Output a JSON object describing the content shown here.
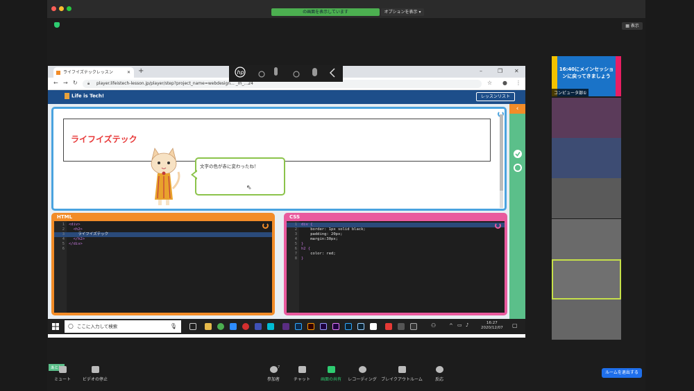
{
  "zoom": {
    "share_status": "の画面を表示しています",
    "options_label": "オプションを表示",
    "view_label": "表示",
    "bottom": {
      "mute": "ミュート",
      "video_stop": "ビデオの停止",
      "participants": "参加者",
      "participants_count": "7",
      "chat": "チャット",
      "share": "画面の共有",
      "record": "レコーディング",
      "breakout": "ブレイクアウトルーム",
      "reactions": "反応",
      "leave": "ルームを退出する",
      "speaker_tag": "あとし"
    },
    "gallery": {
      "banner_text": "16:40にメインセッションに戻ってきましょう",
      "first_name": "コンピュータ部①"
    }
  },
  "browser": {
    "tab_title": "ライフイズテックレッスン",
    "new_tab": "+",
    "url": "player.lifeistech-lesson.jp/player/step?project_name=webdesign... _m_...24",
    "minimize": "–",
    "maximize": "❐",
    "close": "✕",
    "tab_close": "✕"
  },
  "site": {
    "logo": "Life is Tech!",
    "lesson_list": "レッスンリスト",
    "preview_heading": "ライフイズテック",
    "bubble_text": "文字の色が赤に変わったね！"
  },
  "html_editor": {
    "title": "HTML",
    "lines": [
      {
        "n": "1",
        "code": "<div>"
      },
      {
        "n": "2",
        "code": "  <h2>"
      },
      {
        "n": "3",
        "code": "    ライフイズテック"
      },
      {
        "n": "4",
        "code": "  </h2>"
      },
      {
        "n": "5",
        "code": "</div>"
      },
      {
        "n": "6",
        "code": ""
      }
    ]
  },
  "css_editor": {
    "title": "CSS",
    "lines": [
      {
        "n": "1",
        "code": "div {"
      },
      {
        "n": "2",
        "code": "    border: 1px solid black;"
      },
      {
        "n": "3",
        "code": "    padding: 20px;"
      },
      {
        "n": "4",
        "code": "    margin:30px;"
      },
      {
        "n": "5",
        "code": "}"
      },
      {
        "n": "6",
        "code": "h2 {"
      },
      {
        "n": "7",
        "code": "    color: red;"
      },
      {
        "n": "8",
        "code": "}"
      }
    ]
  },
  "taskbar": {
    "search_placeholder": "ここに入力して検索",
    "time": "16:27",
    "date": "2020/12/07"
  },
  "colors": {
    "html_panel": "#f28c28",
    "css_panel": "#e95a9e",
    "preview_border": "#4aa3df",
    "side_green": "#5bbf8a"
  }
}
